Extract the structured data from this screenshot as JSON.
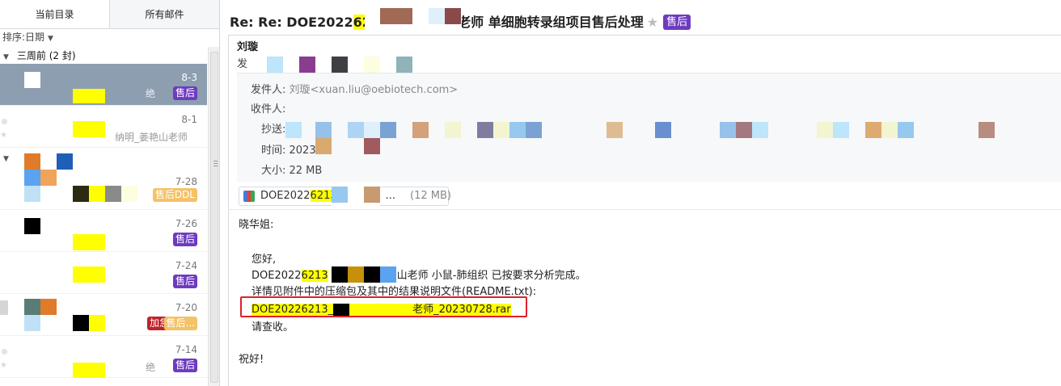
{
  "tabs": {
    "current_folder": "当前目录",
    "all_mail": "所有邮件"
  },
  "sort": {
    "label": "排序:日期"
  },
  "list": {
    "groups": [
      {
        "label": "三周前 (2 封)"
      }
    ],
    "items": [
      {
        "date": "8-3",
        "snippet": "绝",
        "badge": "售后"
      },
      {
        "date": "8-1",
        "snippet": "纳明_姜艳山老师"
      },
      {
        "date": "7-28",
        "badge": "售后DDL"
      },
      {
        "date": "7-26",
        "badge": "售后"
      },
      {
        "date": "7-24",
        "badge": "售后"
      },
      {
        "date": "7-20",
        "badge_urgent": "加急",
        "badge": "售后..."
      },
      {
        "date": "7-14",
        "snippet": "绝",
        "badge": "售后"
      }
    ]
  },
  "message": {
    "subject_prefix": "Re: Re: DOE2022",
    "subject_hl": "6213",
    "subject_suffix": "老师 单细胞转录组项目售后处理",
    "tag": "售后",
    "sender_name": "刘璇",
    "sender_sub": "发",
    "from_label": "发件人:",
    "from_value": "刘璇<xuan.liu@oebiotech.com>",
    "to_label": "收件人:",
    "cc_label": "抄送:",
    "time_label": "时间: 2023",
    "size_label": "大小: 22 MB",
    "attachment": {
      "name_prefix": "DOE2022",
      "name_hl": "6213",
      "name_suffix": "...",
      "size": "(12 MB)"
    },
    "body": {
      "greeting": "晓华姐:",
      "hello": "您好,",
      "line1_prefix": "DOE2022",
      "line1_hl": "6213",
      "line1_suffix": "山老师 小鼠-肺组织 已按要求分析完成。",
      "line2": "详情见附件中的压缩包及其中的结果说明文件(README.txt):",
      "file_prefix": "DOE20226213_",
      "file_suffix": "老师_20230728.rar",
      "please": "请查收。",
      "closing": "祝好!"
    }
  },
  "colors": {
    "tag_purple": "#6e3bbf",
    "highlight": "#ffff00",
    "urgent_red": "#c0222a",
    "ddl_orange": "#f4c268",
    "callout_red": "#e0202a"
  }
}
